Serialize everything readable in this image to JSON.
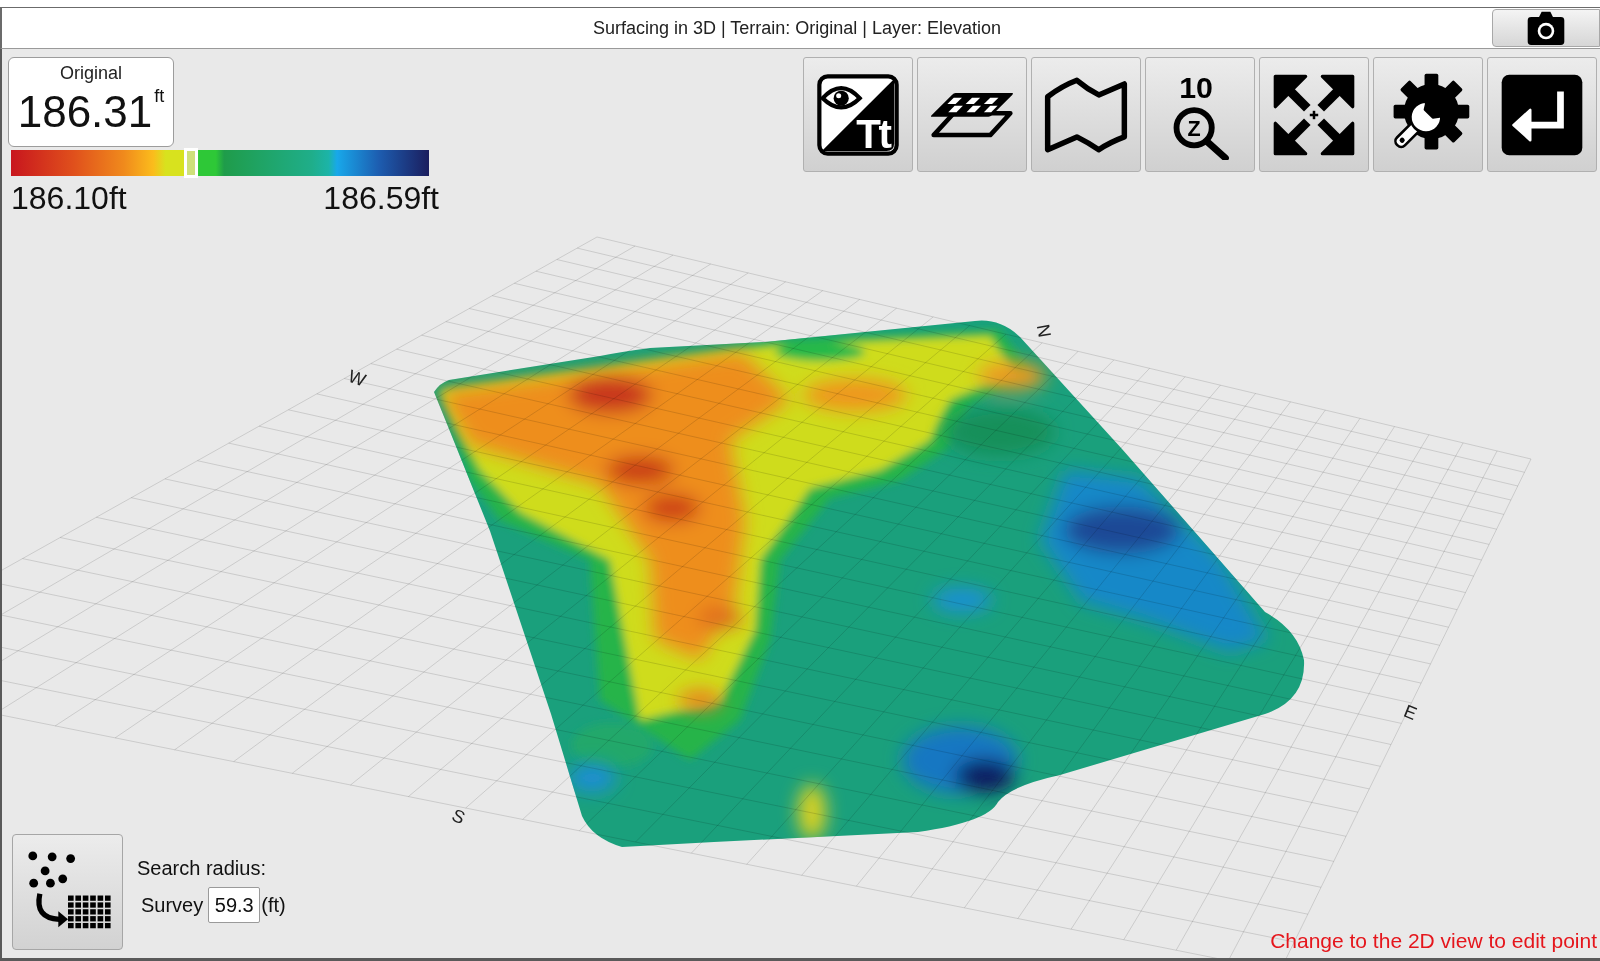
{
  "window": {
    "title": "Surfacing in 3D | Terrain: Original | Layer: Elevation"
  },
  "readout": {
    "label": "Original",
    "value": "186.31",
    "unit": "ft"
  },
  "legend": {
    "min": "186.10ft",
    "max": "186.59ft",
    "level": 0.43
  },
  "toolbar": {
    "visibility_glyph": "Tt",
    "zoom_level": "10",
    "zoom_glyph": "Z"
  },
  "compass": [
    {
      "label": "N"
    },
    {
      "label": "W"
    },
    {
      "label": "E"
    },
    {
      "label": "S"
    }
  ],
  "search_radius": {
    "label": "Search radius:",
    "source": "Survey",
    "value": "59.3",
    "unit": "(ft)"
  },
  "status_message": "Change to the 2D view to edit point"
}
